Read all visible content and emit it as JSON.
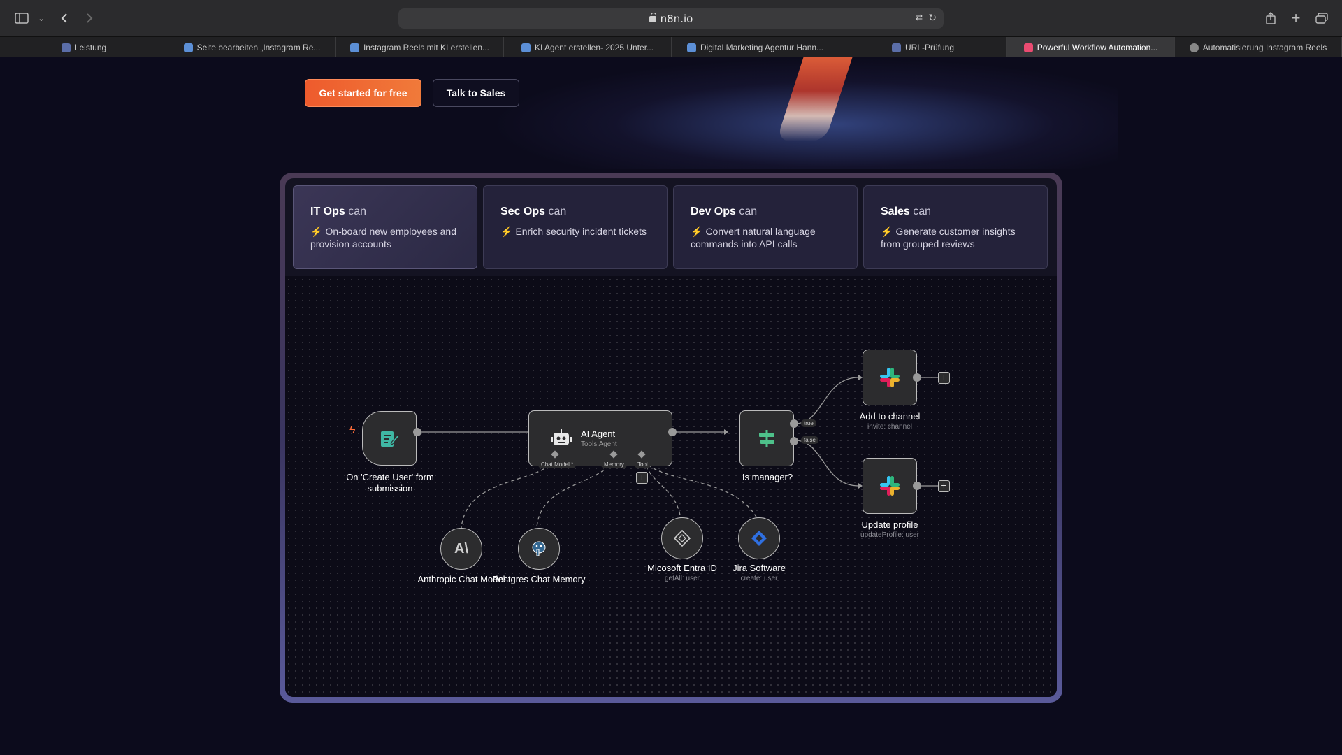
{
  "browser": {
    "url": "n8n.io",
    "tabs": [
      {
        "label": "Leistung",
        "color": "#5b6ea8"
      },
      {
        "label": "Seite bearbeiten „Instagram Re...",
        "color": "#5c8fd6"
      },
      {
        "label": "Instagram Reels mit KI erstellen...",
        "color": "#5c8fd6"
      },
      {
        "label": "KI Agent erstellen- 2025 Unter...",
        "color": "#5c8fd6"
      },
      {
        "label": "Digital Marketing Agentur Hann...",
        "color": "#5c8fd6"
      },
      {
        "label": "URL-Prüfung",
        "color": "#5b6ea8"
      },
      {
        "label": "Powerful Workflow Automation...",
        "color": "#ea4b71"
      },
      {
        "label": "Automatisierung Instagram Reels",
        "color": "#888888"
      }
    ],
    "active_tab": 6
  },
  "hero": {
    "primary_button": "Get started for free",
    "secondary_button": "Talk to Sales"
  },
  "cards": [
    {
      "team": "IT Ops",
      "can": "can",
      "desc": "On-board new employees and provision accounts",
      "active": true
    },
    {
      "team": "Sec Ops",
      "can": "can",
      "desc": "Enrich security incident tickets",
      "active": false
    },
    {
      "team": "Dev Ops",
      "can": "can",
      "desc": "Convert natural language commands into API calls",
      "active": false
    },
    {
      "team": "Sales",
      "can": "can",
      "desc": "Generate customer insights from grouped reviews",
      "active": false
    }
  ],
  "workflow": {
    "trigger": {
      "label": "On 'Create User' form submission"
    },
    "agent": {
      "title": "AI Agent",
      "subtitle": "Tools Agent",
      "ports": [
        "Chat Model *",
        "Memory",
        "Tool"
      ]
    },
    "switch": {
      "label": "Is manager?",
      "ports": [
        "true",
        "false"
      ]
    },
    "slack_add": {
      "label": "Add to channel",
      "sub": "invite: channel"
    },
    "slack_update": {
      "label": "Update profile",
      "sub": "updateProfile: user"
    },
    "anthropic": {
      "label": "Anthropic Chat Model"
    },
    "postgres": {
      "label": "Postgres Chat Memory"
    },
    "entra": {
      "label": "Micosoft Entra ID",
      "sub": "getAll: user"
    },
    "jira": {
      "label": "Jira Software",
      "sub": "create: user"
    }
  },
  "colors": {
    "accent": "#ee5b2d",
    "trigger_bolt": "#ff6d3a",
    "form_icon": "#3fb7a4",
    "switch_icon": "#4ec18a",
    "jira_icon": "#2f6fe0"
  }
}
